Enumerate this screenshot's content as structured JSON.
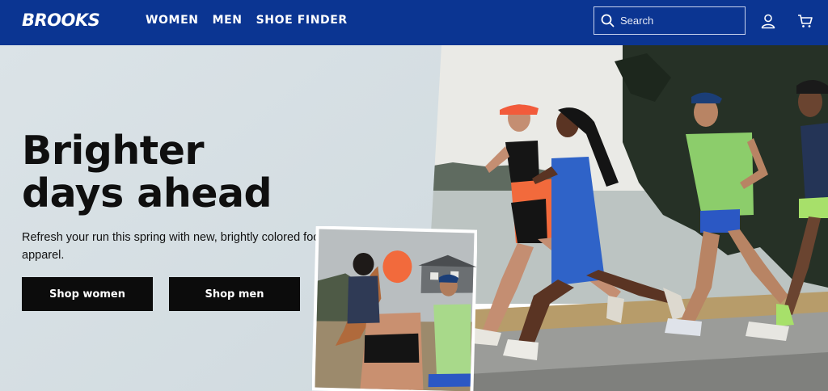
{
  "brand": {
    "logo_text": "BROOKS",
    "nav_bg": "#0b3592"
  },
  "nav": {
    "links": [
      "WOMEN",
      "MEN",
      "SHOE FINDER"
    ],
    "search_placeholder": "Search",
    "icons": [
      "search-icon",
      "account-icon",
      "cart-icon"
    ]
  },
  "hero": {
    "headline_line1": "Brighter",
    "headline_line2": "days ahead",
    "subtext": "Refresh your run this spring with new, brightly colored footwear and apparel.",
    "cta_women": "Shop women",
    "cta_men": "Shop men"
  }
}
